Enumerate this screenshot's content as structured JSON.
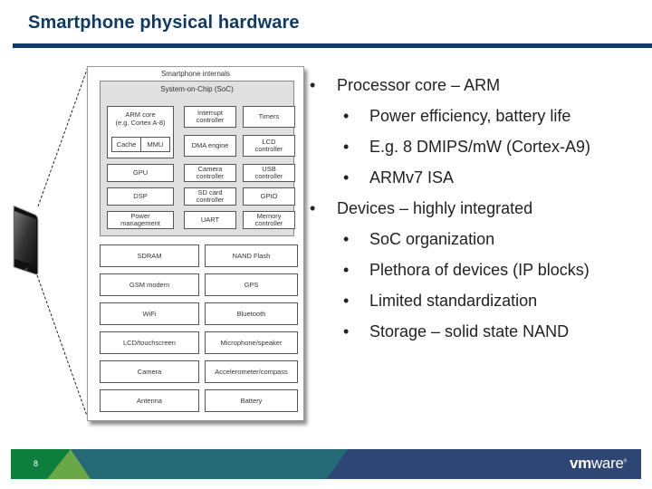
{
  "slide": {
    "title": "Smartphone physical hardware",
    "page_number": "8",
    "logo": {
      "bold": "vm",
      "regular": "ware",
      "mark": "®"
    }
  },
  "diagram": {
    "title": "Smartphone internals",
    "soc": {
      "title": "System-on-Chip (SoC)",
      "arm_core": {
        "label": "ARM core\n(e.g. Cortex A-8)",
        "sub_blocks": [
          "Cache",
          "MMU"
        ]
      },
      "blocks": [
        "Interrupt\ncontroller",
        "Timers",
        "DMA engine",
        "LCD\ncontroller",
        "GPU",
        "Camera\ncontroller",
        "USB\ncontroller",
        "DSP",
        "SD card\ncontroller",
        "GPIO",
        "Power\nmanagement",
        "UART",
        "Memory\ncontroller"
      ]
    },
    "peripherals": [
      "SDRAM",
      "NAND Flash",
      "GSM modem",
      "GPS",
      "WiFi",
      "Bluetooth",
      "LCD/touchscreen",
      "Microphone/speaker",
      "Camera",
      "Accelerometer/compass",
      "Antenna",
      "Battery"
    ]
  },
  "bullets": [
    {
      "level": 1,
      "text": "Processor core – ARM"
    },
    {
      "level": 2,
      "text": "Power efficiency, battery life"
    },
    {
      "level": 2,
      "text": "E.g. 8 DMIPS/mW (Cortex-A9)"
    },
    {
      "level": 2,
      "text": "ARMv7 ISA"
    },
    {
      "level": 1,
      "text": "Devices – highly integrated"
    },
    {
      "level": 2,
      "text": "SoC organization"
    },
    {
      "level": 2,
      "text": "Plethora of devices (IP blocks)"
    },
    {
      "level": 2,
      "text": "Limited standardization"
    },
    {
      "level": 2,
      "text": "Storage – solid state NAND"
    }
  ],
  "bullet_glyph": "•",
  "colors": {
    "title": "#0f3a66",
    "footer_green": "#0d7f3d",
    "footer_light_green": "#6aa746",
    "footer_teal": "#236a76",
    "footer_navy": "#2d4673"
  }
}
